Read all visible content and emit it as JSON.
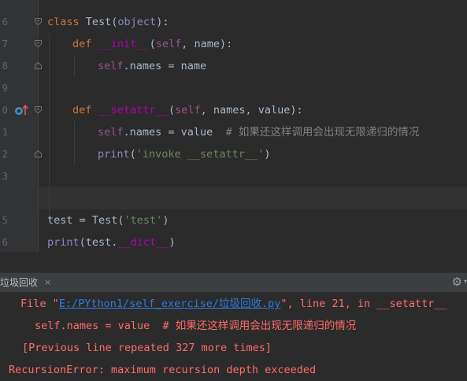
{
  "editor": {
    "line_numbers": [
      "6",
      "7",
      "8",
      "9",
      "0",
      "1",
      "2",
      "3",
      "5",
      "6"
    ],
    "code": {
      "l6": {
        "kw": "class",
        "name": " Test(",
        "base": "object",
        "end": "):"
      },
      "l7": {
        "kw": "def",
        "fn": "__init__",
        "open": "(",
        "self": "self",
        "rest": ", name):"
      },
      "l8": {
        "self": "self",
        "rest": ".names = name"
      },
      "l0": {
        "kw": "def",
        "fn": "__setattr__",
        "open": "(",
        "self": "self",
        "rest": ", names, value):"
      },
      "l1": {
        "self": "self",
        "rest": ".names = value  ",
        "comment": "# 如果还这样调用会出现无限递归的情况"
      },
      "l2": {
        "builtin": "print",
        "open": "(",
        "str": "'invoke __setattr__'",
        "close": ")"
      },
      "l5": {
        "pre": "test = Test(",
        "str": "'test'",
        "close": ")"
      },
      "l6b": {
        "builtin": "print",
        "open": "(test.",
        "dunder": "__dict__",
        "close": ")"
      }
    }
  },
  "panel": {
    "tab_label": "垃圾回收",
    "close_glyph": "×",
    "gear_glyph": "⚙",
    "gear_arrow": "▾"
  },
  "console": {
    "file_prefix": "File \"",
    "file_link": "E:/PYthon1/self_exercise/垃圾回收.py",
    "file_suffix": "\", line 21, in __setattr__",
    "code_line": "self.names = value  # 如果还这样调用会出现无限递归的情况",
    "repeat_line": "[Previous line repeated 327 more times]",
    "error_line": "RecursionError: maximum recursion depth exceeded"
  },
  "colors": {
    "background": "#2b2b2b",
    "keyword": "#cc7832",
    "magic": "#b200b2",
    "self": "#94558d",
    "string": "#6a8759",
    "error": "#ff6b68",
    "link": "#287bde"
  },
  "icons": [
    "fold-marker-icon",
    "override-method-icon",
    "close-icon",
    "gear-icon"
  ]
}
